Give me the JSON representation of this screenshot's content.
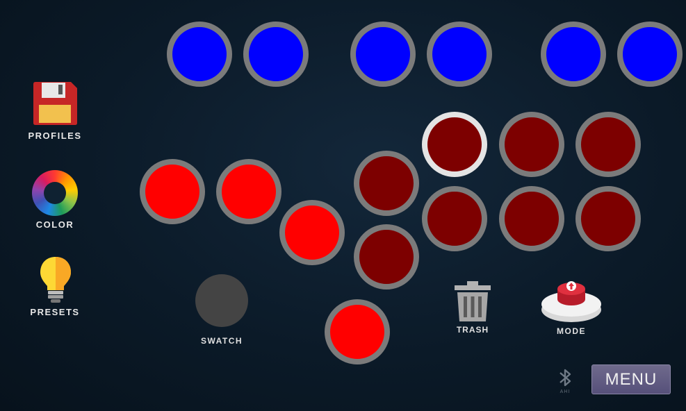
{
  "sidebar": {
    "profiles_label": "PROFILES",
    "color_label": "COLOR",
    "presets_label": "PRESETS"
  },
  "swatch": {
    "label": "SWATCH",
    "color": "#444444"
  },
  "trash": {
    "label": "TRASH"
  },
  "mode": {
    "label": "MODE"
  },
  "menu": {
    "label": "MENU"
  },
  "bluetooth": {
    "icon": "bluetooth-icon",
    "caption": "AHI"
  },
  "colors": {
    "blue": "#0000ff",
    "red": "#ff0000",
    "dark_red": "#7d0000",
    "ring": "#7b7b7b",
    "selected_ring": "#e4e4e4"
  }
}
